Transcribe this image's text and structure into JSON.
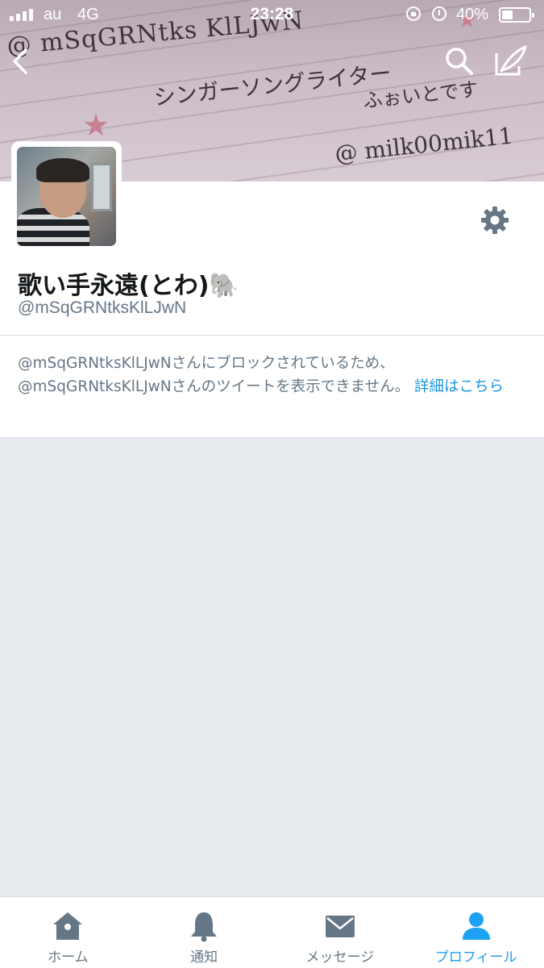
{
  "status_bar": {
    "carrier": "au",
    "network": "4G",
    "time": "23:28",
    "battery": "40%",
    "battery_level": 0.4,
    "icons": [
      "signal-icon",
      "rotation-lock-icon",
      "alarm-icon",
      "battery-icon"
    ]
  },
  "banner": {
    "line1": "@ mSqGRNtks KlLJwN",
    "line2": "シンガーソングライター",
    "line3": "ふぉいとです",
    "line4": "@ milk00mik11"
  },
  "header": {
    "icons": [
      "back-icon",
      "search-icon",
      "compose-icon"
    ]
  },
  "profile": {
    "display_name": "歌い手永遠(とわ)🐘",
    "handle": "@mSqGRNtksKlLJwN",
    "settings_icon": "gear-icon"
  },
  "blocked_notice": {
    "message": "@mSqGRNtksKlLJwNさんにブロックされているため、@mSqGRNtksKlLJwNさんのツイートを表示できません。",
    "link": "詳細はこちら"
  },
  "tabs": [
    {
      "label": "ホーム",
      "icon": "home-icon"
    },
    {
      "label": "通知",
      "icon": "bell-icon"
    },
    {
      "label": "メッセージ",
      "icon": "envelope-icon"
    },
    {
      "label": "プロフィール",
      "icon": "person-icon",
      "active": true
    }
  ],
  "colors": {
    "accent": "#1da1f2",
    "link": "#1b95e0",
    "muted": "#657786",
    "background": "#e6ecf0"
  }
}
